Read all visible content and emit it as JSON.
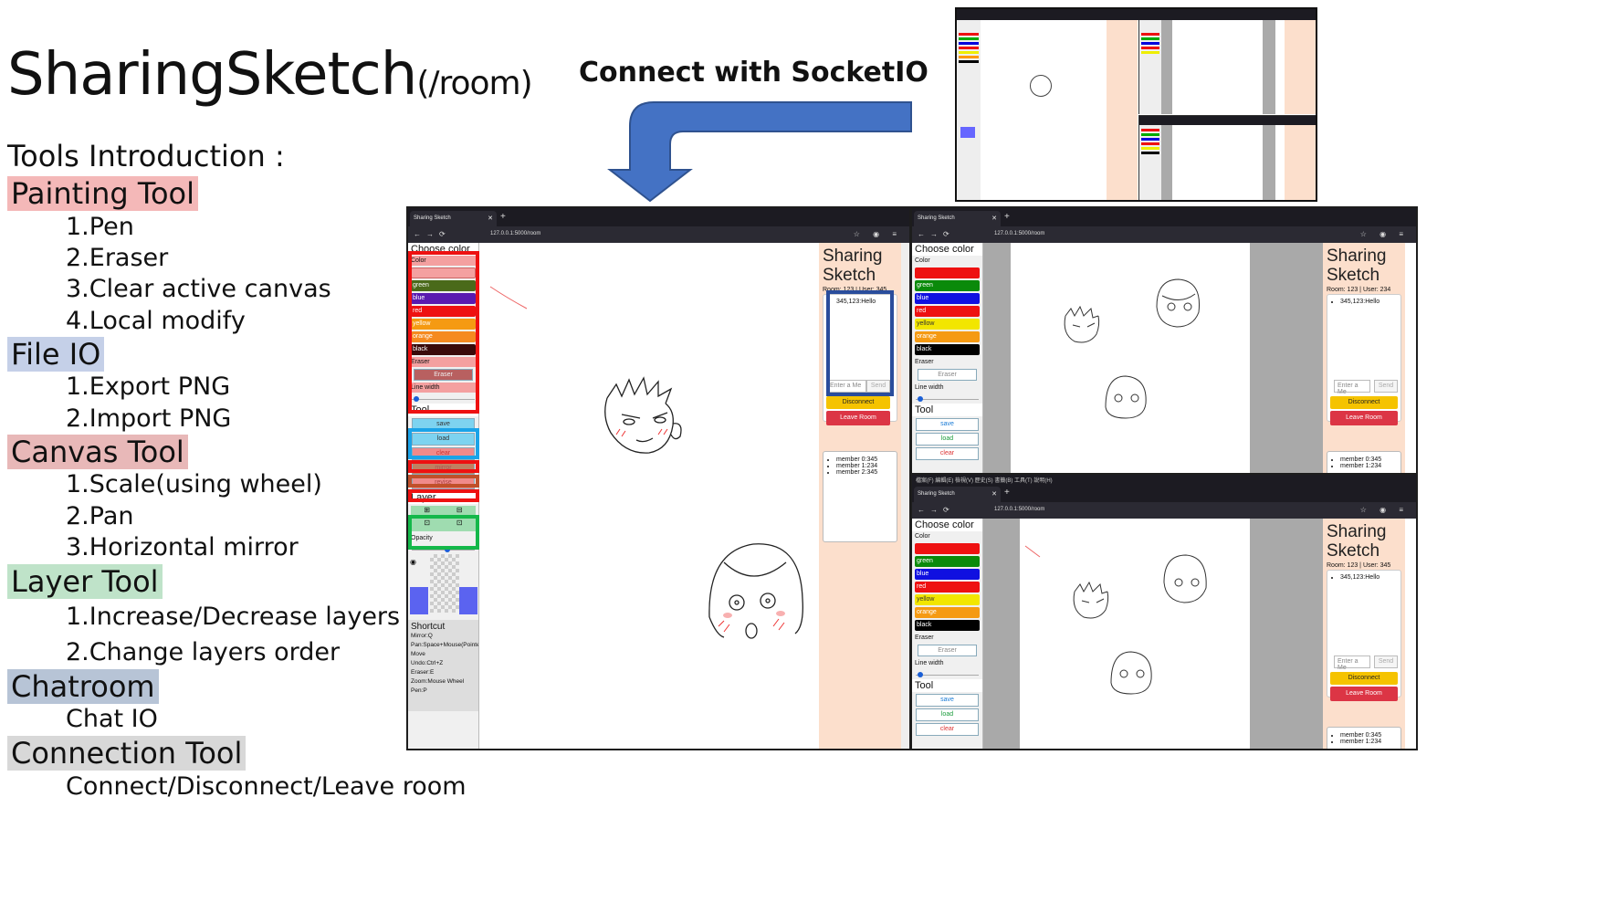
{
  "title": {
    "main": "SharingSketch",
    "sub": "(/room)"
  },
  "intro": "Tools Introduction :",
  "categories": [
    {
      "name": "Painting Tool",
      "color": "#f4b8b8",
      "items": [
        "1.Pen",
        "2.Eraser",
        "3.Clear active canvas",
        "4.Local modify"
      ]
    },
    {
      "name": "File IO",
      "color": "#c5d0e8",
      "items": [
        "1.Export PNG",
        "2.Import PNG"
      ]
    },
    {
      "name": "Canvas Tool",
      "color": "#e8b8b8",
      "items": [
        "1.Scale(using wheel)",
        "2.Pan",
        "3.Horizontal mirror"
      ]
    },
    {
      "name": "Layer Tool",
      "color": "#bfe3c9",
      "items": [
        "1.Increase/Decrease layers",
        "2.Change layers order"
      ]
    },
    {
      "name": "Chatroom",
      "color": "#b7c4d6",
      "items": [
        "Chat IO"
      ]
    },
    {
      "name": "Connection Tool",
      "color": "#d8d8d8",
      "items": [
        "Connect/Disconnect/Leave room"
      ]
    }
  ],
  "socket_label": "Connect with SocketIO",
  "browser": {
    "tab_title": "Sharing Sketch",
    "url": "127.0.0.1:5000/room",
    "menu_bar": "檔案(F)  編輯(E)  檢視(V)  歷史(S)  書籤(B)  工具(T)  說明(H)"
  },
  "app": {
    "choose_color": "Choose color",
    "color_label": "Color",
    "colors": [
      {
        "name": "green",
        "hex": "#0a8a0a"
      },
      {
        "name": "blue",
        "hex": "#1010e0"
      },
      {
        "name": "red",
        "hex": "#ee1111"
      },
      {
        "name": "yellow",
        "hex": "#f2e600"
      },
      {
        "name": "orange",
        "hex": "#f59a12"
      },
      {
        "name": "black",
        "hex": "#000000"
      }
    ],
    "eraser_label": "Eraser",
    "eraser_button": "Eraser",
    "line_width": "Line width",
    "tool_label": "Tool",
    "tools": [
      "save",
      "load",
      "clear",
      "mirror",
      "revise"
    ],
    "layer_label": "Layer",
    "opacity_label": "Opacity",
    "shortcut_label": "Shortcut",
    "shortcuts": [
      "Mirror:Q",
      "Pan:Space+Mouse(Pointer)",
      "Move",
      "Undo:Ctrl+Z",
      "Eraser:E",
      "Zoom:Mouse Wheel",
      "Pen:P"
    ],
    "sharing_title_1": "Sharing",
    "sharing_title_2": "Sketch",
    "room_info_main": "Room: 123 | User: 345",
    "room_info_234": "Room: 123 | User: 234",
    "room_info_345": "Room: 123 | User: 345",
    "chat_message": "345,123:Hello",
    "chat_placeholder": "Enter a Me",
    "send": "Send",
    "disconnect": "Disconnect",
    "leave_room": "Leave Room",
    "members": [
      "member 0:345",
      "member 1:234",
      "member 2:345"
    ]
  },
  "highlight_colors": {
    "painting": "#ee1111",
    "file_io": "#1aa3e8",
    "canvas": "#ee1111",
    "layer": "#14b84a",
    "chat": "#2a4d9c"
  }
}
